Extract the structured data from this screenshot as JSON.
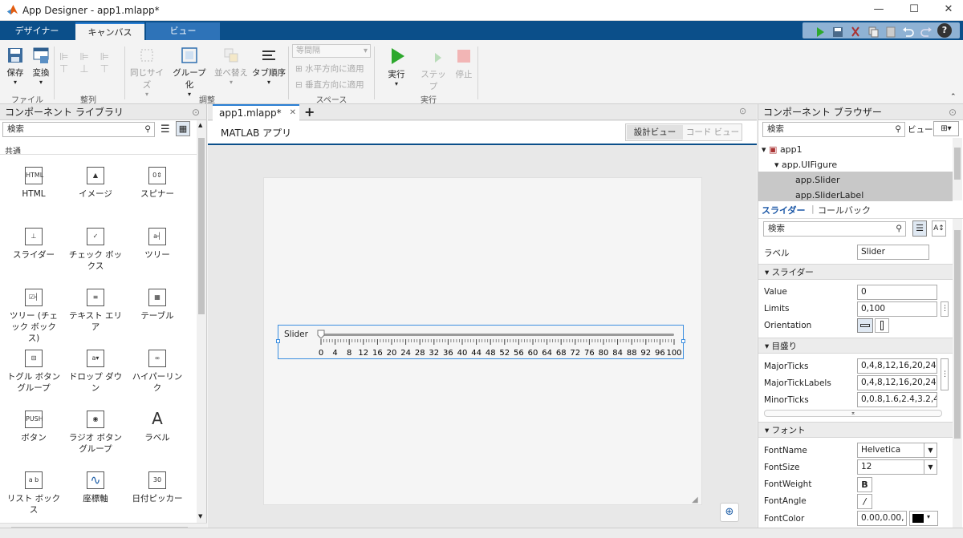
{
  "window": {
    "title": "App Designer - app1.mlapp*"
  },
  "tabs": {
    "designer": "デザイナー",
    "canvas": "キャンバス",
    "view": "ビュー"
  },
  "ribbon": {
    "save": "保存",
    "convert": "変換",
    "file_group": "ファイル",
    "align_group": "整列",
    "same_size": "同じサイズ",
    "group": "グループ化",
    "arrange": "並べ替え",
    "tab_order": "タブ順序",
    "adjust_group": "調整",
    "spacing_select": "等間隔",
    "apply_h": "水平方向に適用",
    "apply_v": "垂直方向に適用",
    "space_group": "スペース",
    "run": "実行",
    "step": "ステップ",
    "stop": "停止",
    "run_group": "実行"
  },
  "library": {
    "title": "コンポーネント ライブラリ",
    "search_placeholder": "検索",
    "category": "共通",
    "items": [
      {
        "label": "HTML",
        "icon": "html-icon"
      },
      {
        "label": "イメージ",
        "icon": "image-icon"
      },
      {
        "label": "スピナー",
        "icon": "spinner-icon"
      },
      {
        "label": "スライダー",
        "icon": "slider-icon"
      },
      {
        "label": "チェック ボックス",
        "icon": "checkbox-icon"
      },
      {
        "label": "ツリー",
        "icon": "tree-icon"
      },
      {
        "label": "ツリー (チェック ボックス)",
        "icon": "checkbox-tree-icon"
      },
      {
        "label": "テキスト エリア",
        "icon": "text-area-icon"
      },
      {
        "label": "テーブル",
        "icon": "table-icon"
      },
      {
        "label": "トグル ボタン グループ",
        "icon": "toggle-button-group-icon"
      },
      {
        "label": "ドロップ ダウン",
        "icon": "dropdown-icon"
      },
      {
        "label": "ハイパーリンク",
        "icon": "hyperlink-icon"
      },
      {
        "label": "ボタン",
        "icon": "button-icon"
      },
      {
        "label": "ラジオ ボタン グループ",
        "icon": "radio-button-group-icon"
      },
      {
        "label": "ラベル",
        "icon": "label-icon"
      },
      {
        "label": "リスト ボックス",
        "icon": "list-box-icon"
      },
      {
        "label": "座標軸",
        "icon": "axes-icon"
      },
      {
        "label": "日付ピッカー",
        "icon": "date-picker-icon"
      }
    ]
  },
  "editor": {
    "tab": "app1.mlapp*",
    "app_title": "MATLAB アプリ",
    "design_view": "設計ビュー",
    "code_view": "コード ビュー"
  },
  "slider": {
    "label": "Slider",
    "ticks": [
      "0",
      "4",
      "8",
      "12",
      "16",
      "20",
      "24",
      "28",
      "32",
      "36",
      "40",
      "44",
      "48",
      "52",
      "56",
      "60",
      "64",
      "68",
      "72",
      "76",
      "80",
      "84",
      "88",
      "92",
      "96",
      "100"
    ],
    "value": 0,
    "limits": [
      0,
      100
    ]
  },
  "browser": {
    "title": "コンポーネント ブラウザー",
    "search_placeholder": "検索",
    "view_label": "ビュー:",
    "tree": [
      "app1",
      "app.UIFigure",
      "app.Slider",
      "app.SliderLabel"
    ]
  },
  "inspector": {
    "tab_slider": "スライダー",
    "tab_callbacks": "コールバック",
    "search_placeholder": "検索",
    "label_key": "ラベル",
    "label_val": "Slider",
    "sec_slider": "スライダー",
    "value_key": "Value",
    "value_val": "0",
    "limits_key": "Limits",
    "limits_val": "0,100",
    "orientation_key": "Orientation",
    "sec_ticks": "目盛り",
    "major_key": "MajorTicks",
    "major_val": "0,4,8,12,16,20,24,2",
    "majorlabels_key": "MajorTickLabels",
    "majorlabels_val": "0,4,8,12,16,20,24,2",
    "minor_key": "MinorTicks",
    "minor_val": "0,0.8,1.6,2.4,3.2,4,-",
    "sec_font": "フォント",
    "fontname_key": "FontName",
    "fontname_val": "Helvetica",
    "fontsize_key": "FontSize",
    "fontsize_val": "12",
    "fontweight_key": "FontWeight",
    "fontangle_key": "FontAngle",
    "fontcolor_key": "FontColor",
    "fontcolor_val": "0.00,0.00,"
  }
}
